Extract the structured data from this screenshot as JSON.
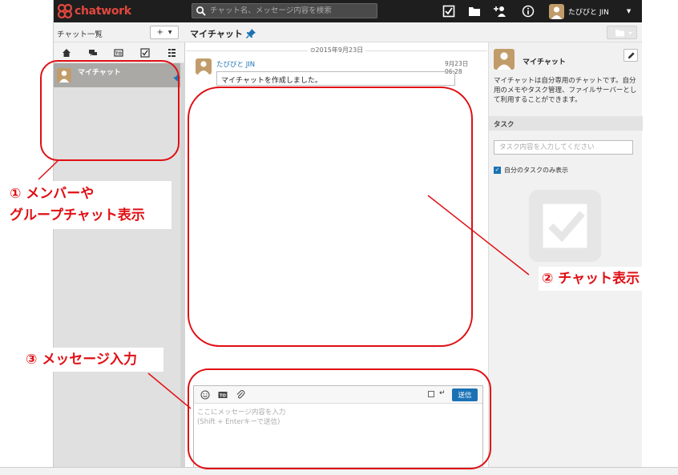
{
  "topbar": {
    "logo_text": "chatwork",
    "search_placeholder": "チャット名、メッセージ内容を検索",
    "user_name": "たびびと JIN",
    "icons": [
      "task-icon",
      "folder-icon",
      "add-contact-icon",
      "info-icon"
    ]
  },
  "sidebar": {
    "title": "チャット一覧",
    "plus_label": "+",
    "filter_icons": [
      "home-icon",
      "mention-icon",
      "todo-icon",
      "checkbox-icon",
      "list-icon"
    ],
    "rooms": [
      {
        "name": "マイチャット"
      }
    ]
  },
  "room": {
    "title": "マイチャット"
  },
  "timeline": {
    "date": "2015年9月23日",
    "messages": [
      {
        "sender": "たびびと JIN",
        "time": "9月23日 06:28",
        "body": "マイチャットを作成しました。"
      }
    ]
  },
  "composer": {
    "send_label": "送信",
    "placeholder": "ここにメッセージ内容を入力\n(Shift + Enterキーで送信)"
  },
  "info_panel": {
    "title": "マイチャット",
    "description": "マイチャットは自分専用のチャットです。自分用のメモやタスク管理、ファイルサーバーとして利用することができます。",
    "task_header": "タスク",
    "task_placeholder": "タスク内容を入力してください",
    "task_filter_label": "自分のタスクのみ表示"
  },
  "annotations": {
    "one_line1": "① メンバーや",
    "one_line2": "グループチャット表示",
    "two": "② チャット表示",
    "three": "③ メッセージ入力",
    "color": "#e00f14"
  }
}
